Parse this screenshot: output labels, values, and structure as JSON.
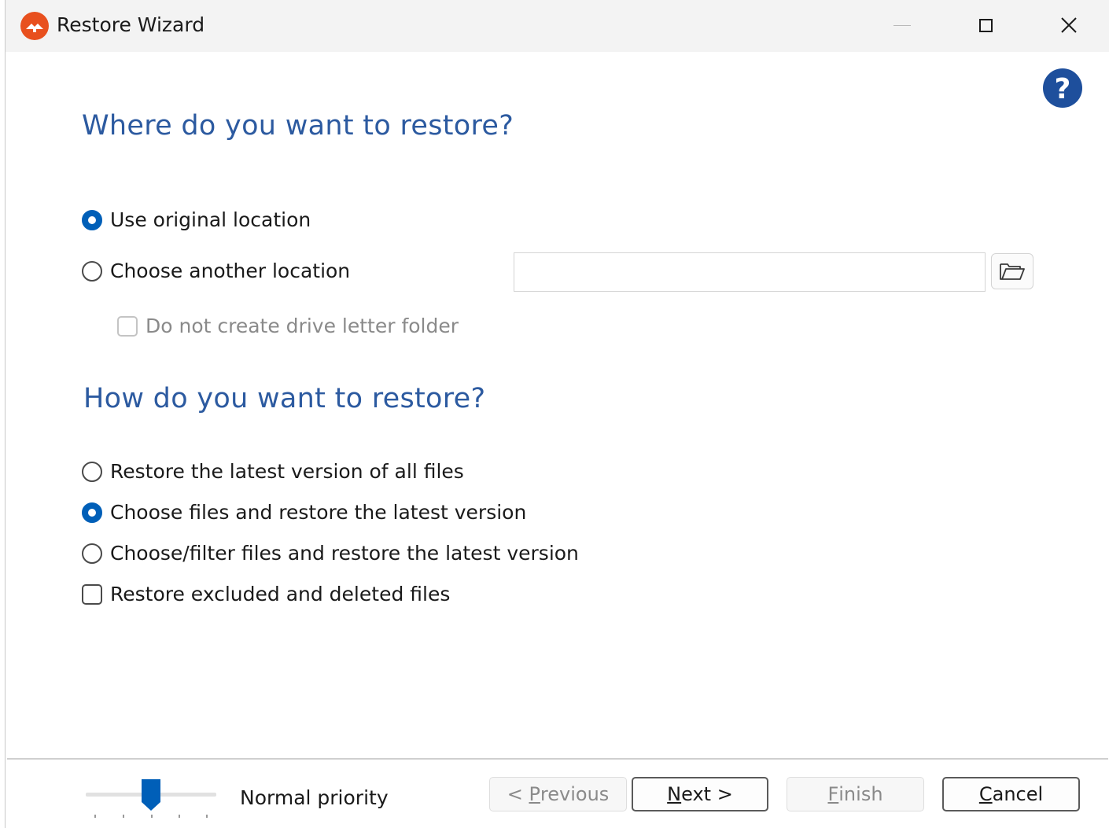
{
  "window": {
    "title": "Restore Wizard",
    "icon": "restore-app-icon",
    "accent_color": "#005fb8",
    "heading_color": "#2c5aa0"
  },
  "help": {
    "icon": "help-question-icon"
  },
  "location": {
    "heading": "Where do you want to restore?",
    "options": [
      {
        "label": "Use original location",
        "selected": true
      },
      {
        "label": "Choose another location",
        "selected": false
      }
    ],
    "path_value": "",
    "browse_icon": "folder-open-icon",
    "no_drive_folder": {
      "label": "Do not create drive letter folder",
      "checked": false,
      "enabled": false
    }
  },
  "method": {
    "heading": "How do you want to restore?",
    "options": [
      {
        "label": "Restore the latest version of all files",
        "selected": false
      },
      {
        "label": "Choose files and restore the latest version",
        "selected": true
      },
      {
        "label": "Choose/filter files and restore the latest version",
        "selected": false
      }
    ],
    "restore_excluded": {
      "label": "Restore excluded and deleted files",
      "checked": false
    }
  },
  "priority": {
    "label": "Normal priority",
    "level": 2,
    "levels": 5
  },
  "buttons": {
    "previous": {
      "pre": "< ",
      "key": "P",
      "rest": "revious",
      "enabled": false
    },
    "next": {
      "pre": "",
      "key": "N",
      "rest": "ext >",
      "enabled": true
    },
    "finish": {
      "pre": "",
      "key": "F",
      "rest": "inish",
      "enabled": false
    },
    "cancel": {
      "pre": "",
      "key": "C",
      "rest": "ancel",
      "enabled": true
    }
  }
}
